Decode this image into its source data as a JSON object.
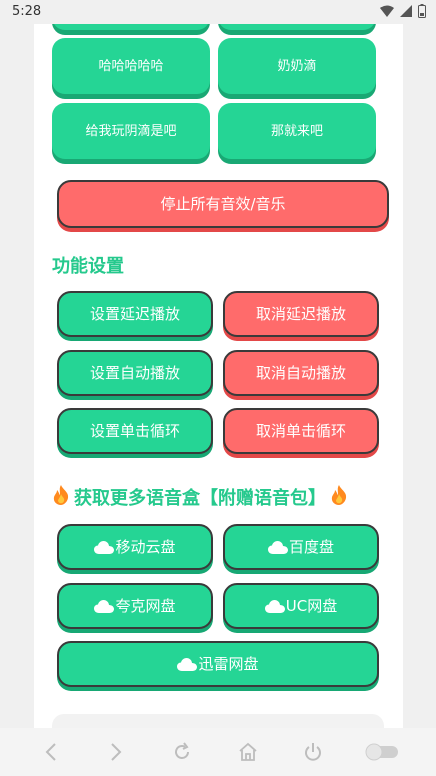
{
  "status": {
    "time": "5:28"
  },
  "sound_buttons": [
    {
      "label": "哈哈哈哈哈"
    },
    {
      "label": "奶奶滴"
    },
    {
      "label": "给我玩阴滴是吧"
    },
    {
      "label": "那就来吧"
    }
  ],
  "stop_all_label": "停止所有音效/音乐",
  "feature_section": {
    "title": "功能设置",
    "buttons": [
      {
        "label": "设置延迟播放"
      },
      {
        "label": "取消延迟播放"
      },
      {
        "label": "设置自动播放"
      },
      {
        "label": "取消自动播放"
      },
      {
        "label": "设置单击循环"
      },
      {
        "label": "取消单击循环"
      }
    ]
  },
  "download_section": {
    "title": "获取更多语音盒【附赠语音包】",
    "buttons": [
      {
        "label": "移动云盘"
      },
      {
        "label": "百度盘"
      },
      {
        "label": "夸克网盘"
      },
      {
        "label": "UC网盘"
      },
      {
        "label": "迅雷网盘"
      }
    ]
  },
  "colors": {
    "green": "#25d595",
    "red": "#ff6b6b",
    "title_green": "#25c98d"
  }
}
